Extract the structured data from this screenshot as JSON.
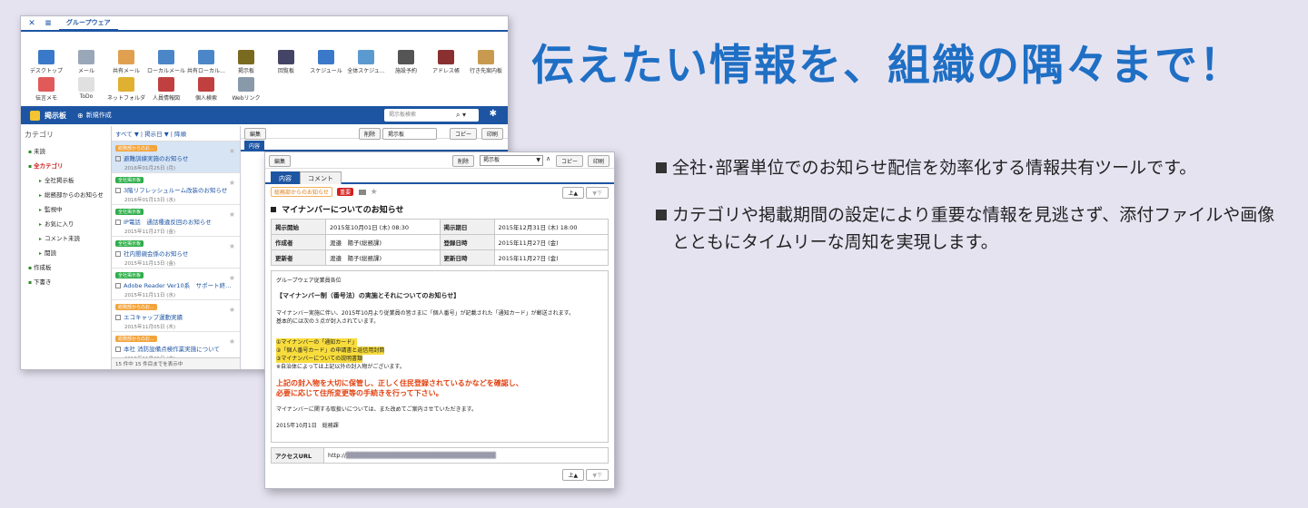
{
  "headline": "伝えたい情報を、組織の隅々まで！",
  "bullets": [
    "全社･部署単位でのお知らせ配信を効率化する情報共有ツールです。",
    "カテゴリや掲載期間の設定により重要な情報を見逃さず、添付ファイルや画像とともにタイムリーな周知を実現します。"
  ],
  "colors": {
    "brand": "#1d55a3",
    "headline": "#1f6fc4",
    "important": "#d42020",
    "highlight": "#f7dc3c",
    "alert_text": "#e0400f"
  },
  "back_window": {
    "tab_label": "グループウェア",
    "apps": [
      {
        "label": "デスクトップ",
        "icon": "monitor-icon"
      },
      {
        "label": "メール",
        "icon": "mail-icon"
      },
      {
        "label": "共有メール",
        "icon": "shared-mail-icon"
      },
      {
        "label": "ローカルメール",
        "icon": "local-mail-icon"
      },
      {
        "label": "共有ローカル…",
        "icon": "shared-local-icon"
      },
      {
        "label": "掲示板",
        "icon": "board-icon"
      },
      {
        "label": "回覧板",
        "icon": "circular-icon"
      },
      {
        "label": "スケジュール",
        "icon": "calendar-icon"
      },
      {
        "label": "全体スケジュ…",
        "icon": "chart-icon"
      },
      {
        "label": "施設予約",
        "icon": "facility-icon"
      },
      {
        "label": "アドレス帳",
        "icon": "address-book-icon"
      },
      {
        "label": "行き先案内板",
        "icon": "destination-icon"
      },
      {
        "label": "伝言メモ",
        "icon": "memo-icon"
      },
      {
        "label": "ToDo",
        "icon": "todo-icon"
      },
      {
        "label": "ネットフォルダ",
        "icon": "folder-icon"
      },
      {
        "label": "人員情報図",
        "icon": "org-icon"
      },
      {
        "label": "個人検索",
        "icon": "people-search-icon"
      },
      {
        "label": "Webリンク",
        "icon": "weblink-icon"
      }
    ],
    "board_title": "掲示板",
    "new_label": "新規作成",
    "search_placeholder": "掲示板検索",
    "sidebar": {
      "heading": "カテゴリ",
      "items": [
        {
          "label": "未読",
          "sub": false
        },
        {
          "label": "全カテゴリ",
          "sub": false,
          "red": true
        },
        {
          "label": "全社掲示板",
          "sub": true
        },
        {
          "label": "総務部からのお知らせ",
          "sub": true
        },
        {
          "label": "監視中",
          "sub": true
        },
        {
          "label": "お気に入り",
          "sub": true
        },
        {
          "label": "コメント未読",
          "sub": true
        },
        {
          "label": "閲読",
          "sub": true
        },
        {
          "label": "作成板",
          "sub": false
        },
        {
          "label": "下書き",
          "sub": false
        }
      ]
    },
    "list_header": "すべて ▼ | 掲示日 ▼ | 降順",
    "list_items": [
      {
        "tag": "総務部からのお…",
        "tag_color": "#f3a33a",
        "title": "避難訓練実施のお知らせ",
        "date": "2016年01月25日 (月)",
        "selected": true
      },
      {
        "tag": "全社掲示板",
        "tag_color": "#2fae4a",
        "title": "3階リフレッシュルーム改装のお知らせ",
        "date": "2016年01月13日 (水)"
      },
      {
        "tag": "全社掲示板",
        "tag_color": "#2fae4a",
        "title": "IP電話　通話種違反回のお知らせ",
        "date": "2015年11月27日 (金)"
      },
      {
        "tag": "全社掲示板",
        "tag_color": "#2fae4a",
        "title": "社内懇親会係のお知らせ",
        "date": "2015年11月13日 (金)"
      },
      {
        "tag": "全社掲示板",
        "tag_color": "#2fae4a",
        "title": "Adobe Reader Ver10系　サポート終…",
        "date": "2015年11月11日 (水)"
      },
      {
        "tag": "総務部からのお…",
        "tag_color": "#f3a33a",
        "title": "エコキャップ運動実績",
        "date": "2015年11月05日 (木)"
      },
      {
        "tag": "総務部からのお…",
        "tag_color": "#f3a33a",
        "title": "本社 消防設備点検作業実施について",
        "date": "2015年11月05日 (木)"
      }
    ],
    "list_footer": "15 件中 15 件目までを表示中",
    "detail_edit": "編集",
    "detail_tab": "内容",
    "detail_delete": "削除",
    "detail_board_select": "掲示板",
    "detail_copy": "コピー",
    "detail_print": "印刷"
  },
  "front_window": {
    "edit_label": "編集",
    "delete_label": "削除",
    "select_value": "掲示板",
    "copy_label": "コピー",
    "print_label": "印刷",
    "tabs": [
      "内容",
      "コメント"
    ],
    "category_tag": "総務部からのお知らせ",
    "important_tag": "重要",
    "nav_up": "上▲",
    "nav_down": "▼下",
    "title": "マイナンバーについてのお知らせ",
    "meta": [
      {
        "k1": "掲示開始",
        "v1": "2015年10月01日 (木) 08:30",
        "k2": "掲示期日",
        "v2": "2015年12月31日 (木) 18:00"
      },
      {
        "k1": "作成者",
        "v1": "渡邉　陽子(総務課)",
        "k2": "登録日時",
        "v2": "2015年11月27日 (金)"
      },
      {
        "k1": "更新者",
        "v1": "渡邉　陽子(総務課)",
        "k2": "更新日時",
        "v2": "2015年11月27日 (金)"
      }
    ],
    "content": {
      "greeting": "グループウェア従業員各位",
      "heading": "【マイナンバー制（番号法）の実施とそれについてのお知らせ】",
      "para1": "マイナンバー実施に伴い、2015年10月より従業員の皆さまに「個人番号」が記載された「通知カード」が郵送されます。",
      "para2": "基本的には次の３点が封入されています。",
      "list": [
        "①マイナンバーの「通知カード」",
        "②「個人番号カード」の申請書と返信用封筒",
        "③マイナンバーについての説明書類"
      ],
      "note": "※自治体によっては上記以外の封入物がございます。",
      "alert1": "上記の封入物を大切に保管し、正しく住民登録されているかなどを確認し、",
      "alert2": "必要に応じて住所変更等の手続きを行って下さい。",
      "closing": "マイナンバーに関する取扱いについては、また改めてご案内させていただきます。",
      "signature": "2015年10月1日　総務課"
    },
    "url_label": "アクセスURL",
    "url_value": "http://"
  }
}
